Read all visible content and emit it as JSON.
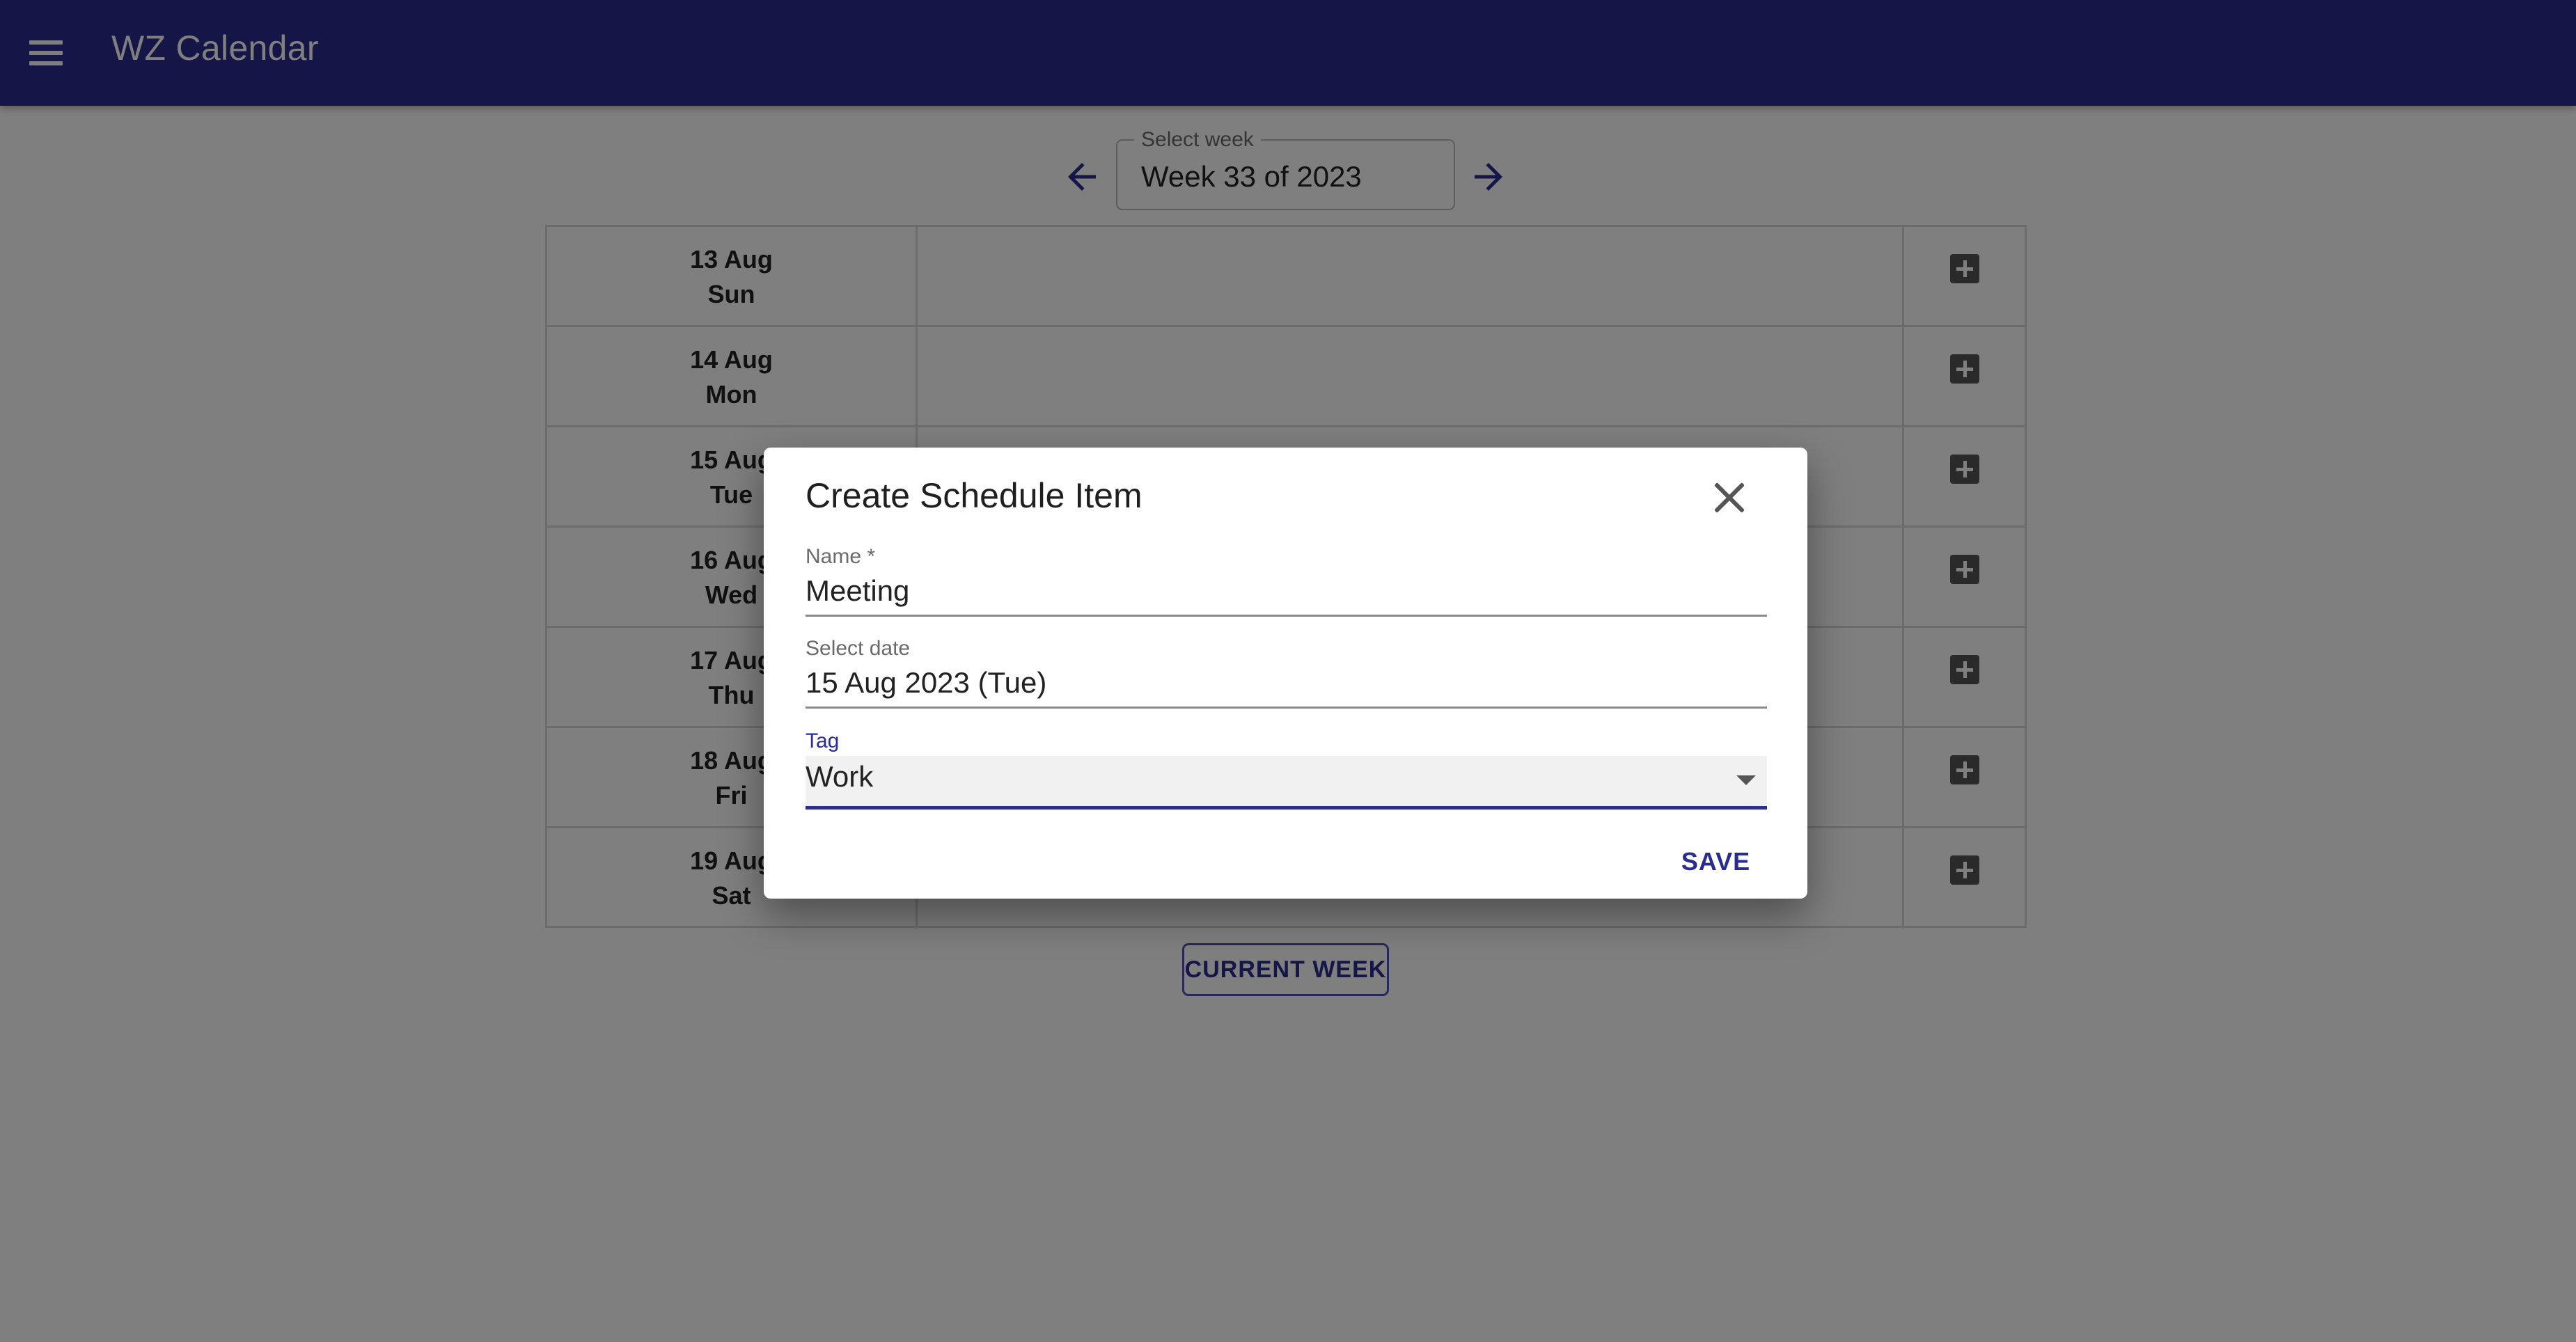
{
  "app": {
    "title": "WZ Calendar"
  },
  "week_selector": {
    "label": "Select week",
    "value": "Week 33 of 2023"
  },
  "calendar": {
    "days": [
      {
        "date": "13 Aug",
        "weekday": "Sun"
      },
      {
        "date": "14 Aug",
        "weekday": "Mon"
      },
      {
        "date": "15 Aug",
        "weekday": "Tue"
      },
      {
        "date": "16 Aug",
        "weekday": "Wed"
      },
      {
        "date": "17 Aug",
        "weekday": "Thu"
      },
      {
        "date": "18 Aug",
        "weekday": "Fri"
      },
      {
        "date": "19 Aug",
        "weekday": "Sat"
      }
    ]
  },
  "current_week_label": "CURRENT WEEK",
  "dialog": {
    "title": "Create Schedule Item",
    "name_label": "Name *",
    "name_value": "Meeting",
    "date_label": "Select date",
    "date_value": "15 Aug 2023 (Tue)",
    "tag_label": "Tag",
    "tag_value": "Work",
    "save_label": "SAVE"
  },
  "colors": {
    "primary": "#2a2d8f",
    "appbar": "#2a2d8f"
  },
  "icons": {
    "menu": "menu-icon",
    "prev": "arrow-left-icon",
    "next": "arrow-right-icon",
    "add": "add-box-icon",
    "close": "close-icon",
    "dropdown": "dropdown-arrow-icon"
  }
}
